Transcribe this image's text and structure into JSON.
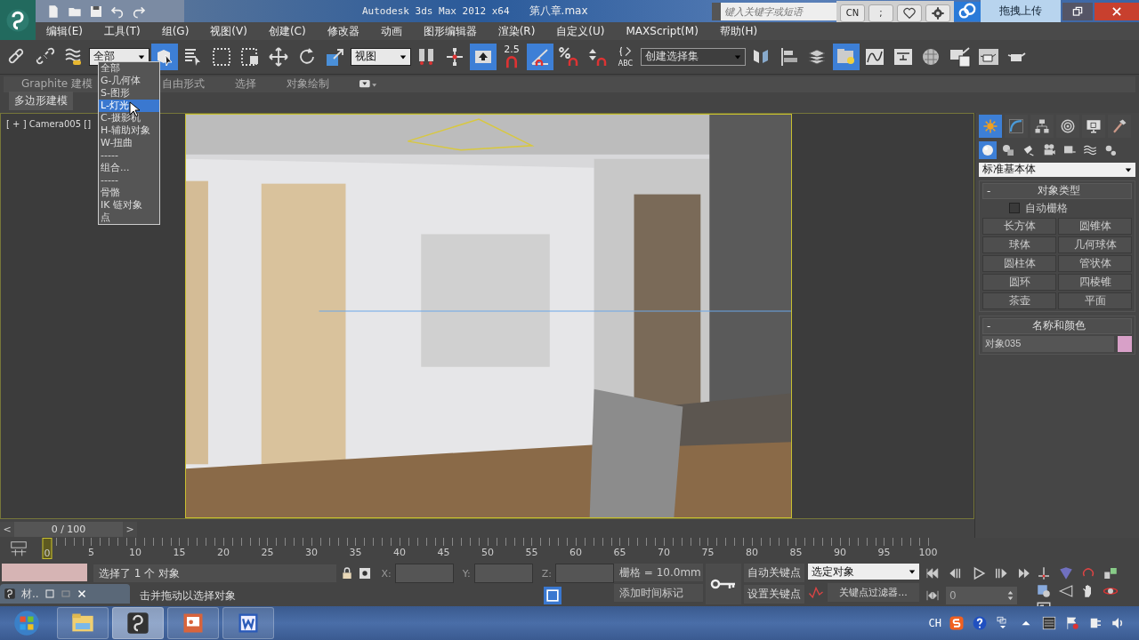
{
  "title_bar": {
    "title": "Autodesk 3ds Max  2012 x64",
    "file": "第八章.max",
    "search": {
      "placeholder": "键入关键字或短语"
    },
    "ime_buttons": [
      {
        "kind": "text",
        "label": "CN"
      },
      {
        "kind": "text",
        "label": ";"
      },
      {
        "kind": "heart"
      },
      {
        "kind": "gear"
      }
    ],
    "upload_button": "拖拽上传"
  },
  "menu": [
    "编辑(E)",
    "工具(T)",
    "组(G)",
    "视图(V)",
    "创建(C)",
    "修改器",
    "动画",
    "图形编辑器",
    "渲染(R)",
    "自定义(U)",
    "MAXScript(M)",
    "帮助(H)"
  ],
  "toolbar": [
    {
      "kind": "link",
      "selected": false
    },
    {
      "kind": "unlink",
      "selected": false
    },
    {
      "kind": "bind",
      "selected": false
    },
    {
      "kind": "dropdown",
      "value": "全部"
    },
    {
      "kind": "select",
      "selected": true
    },
    {
      "kind": "select-name",
      "selected": false
    },
    {
      "kind": "region",
      "selected": false
    },
    {
      "kind": "crossing",
      "selected": false
    },
    {
      "kind": "move",
      "selected": false
    },
    {
      "kind": "rotate",
      "selected": false
    },
    {
      "kind": "scale",
      "selected": false
    },
    {
      "kind": "dropdown",
      "value": "视图"
    },
    {
      "kind": "pivot",
      "selected": false
    },
    {
      "kind": "manipulate",
      "selected": false
    },
    {
      "kind": "keyboard",
      "selected": true
    },
    {
      "kind": "snap",
      "label": "2.5",
      "selected": false
    },
    {
      "kind": "angle-snap",
      "selected": true
    },
    {
      "kind": "percent-snap",
      "selected": false
    },
    {
      "kind": "spinner-snap",
      "selected": false
    },
    {
      "kind": "named-sets",
      "label": "ABC",
      "selected": false
    },
    {
      "kind": "dropdown",
      "value": "创建选择集"
    },
    {
      "kind": "mirror",
      "selected": false
    },
    {
      "kind": "align",
      "selected": false
    },
    {
      "kind": "layers",
      "selected": false
    },
    {
      "kind": "explorer",
      "selected": true
    },
    {
      "kind": "curve-editor",
      "selected": false
    },
    {
      "kind": "schematic",
      "selected": false
    },
    {
      "kind": "material",
      "selected": false
    },
    {
      "kind": "render-setup",
      "selected": false
    },
    {
      "kind": "render-frame",
      "selected": false
    },
    {
      "kind": "render",
      "selected": false
    }
  ],
  "filter_list": [
    {
      "label": "全部",
      "selected": false
    },
    {
      "label": "G-几何体",
      "selected": false
    },
    {
      "label": "S-图形",
      "selected": false
    },
    {
      "label": "L-灯光",
      "selected": true
    },
    {
      "label": "C-摄影机",
      "selected": false
    },
    {
      "label": "H-辅助对象",
      "selected": false
    },
    {
      "label": "W-扭曲",
      "selected": false
    },
    {
      "label": "-----",
      "selected": false
    },
    {
      "label": "组合...",
      "selected": false
    },
    {
      "label": "-----",
      "selected": false
    },
    {
      "label": "骨骼",
      "selected": false
    },
    {
      "label": "IK 链对象",
      "selected": false
    },
    {
      "label": "点",
      "selected": false
    }
  ],
  "ribbon": {
    "tabs": [
      "Graphite 建模",
      "自由形式",
      "选择",
      "对象绘制"
    ],
    "panel": "多边形建模"
  },
  "viewport": {
    "label": "[ + ] Camera005 []"
  },
  "command_panel": {
    "tabs": [
      {
        "kind": "create",
        "selected": true
      },
      {
        "kind": "modify",
        "selected": false
      },
      {
        "kind": "hierarchy",
        "selected": false
      },
      {
        "kind": "motion",
        "selected": false
      },
      {
        "kind": "display",
        "selected": false
      },
      {
        "kind": "utilities",
        "selected": false
      }
    ],
    "categories": [
      {
        "kind": "geometry",
        "selected": true
      },
      {
        "kind": "shapes",
        "selected": false
      },
      {
        "kind": "lights",
        "selected": false
      },
      {
        "kind": "cameras",
        "selected": false
      },
      {
        "kind": "helpers",
        "selected": false
      },
      {
        "kind": "spacewarps",
        "selected": false
      },
      {
        "kind": "systems",
        "selected": false
      }
    ],
    "type_dropdown": "标准基本体",
    "object_type": {
      "toggle": "-",
      "title": "对象类型",
      "autogrid": {
        "label": "自动栅格",
        "checked": false
      },
      "buttons": [
        "长方体",
        "圆锥体",
        "球体",
        "几何球体",
        "圆柱体",
        "管状体",
        "圆环",
        "四棱锥",
        "茶壶",
        "平面"
      ]
    },
    "name_color": {
      "toggle": "-",
      "title": "名称和颜色",
      "name": "对象035",
      "color": "#d8a0c8"
    }
  },
  "time_slider": {
    "prev": "<",
    "label": "0 / 100",
    "next": ">"
  },
  "timeline": {
    "labels": [
      "0",
      "5",
      "10",
      "15",
      "20",
      "25",
      "30",
      "35",
      "40",
      "45",
      "50",
      "55",
      "60",
      "65",
      "70",
      "75",
      "80",
      "85",
      "90",
      "95",
      "100"
    ]
  },
  "status": {
    "selection": "选择了 1 个 对象",
    "prompt": "击并拖动以选择对象",
    "coords": [
      "X:",
      "Y:",
      "Z:"
    ],
    "grid": "栅格 = 10.0mm",
    "time_tag": "添加时间标记",
    "auto_key": "自动关键点",
    "set_key": "设置关键点",
    "key_mode": "选定对象",
    "key_filters": "关键点过滤器...",
    "frame": "0"
  },
  "minimized_window": {
    "title": "材.."
  },
  "taskbar": {
    "apps": [
      {
        "kind": "explorer",
        "selected": false
      },
      {
        "kind": "max",
        "selected": true
      },
      {
        "kind": "powerpoint",
        "selected": false
      },
      {
        "kind": "word",
        "selected": false
      }
    ],
    "language": "CH"
  }
}
